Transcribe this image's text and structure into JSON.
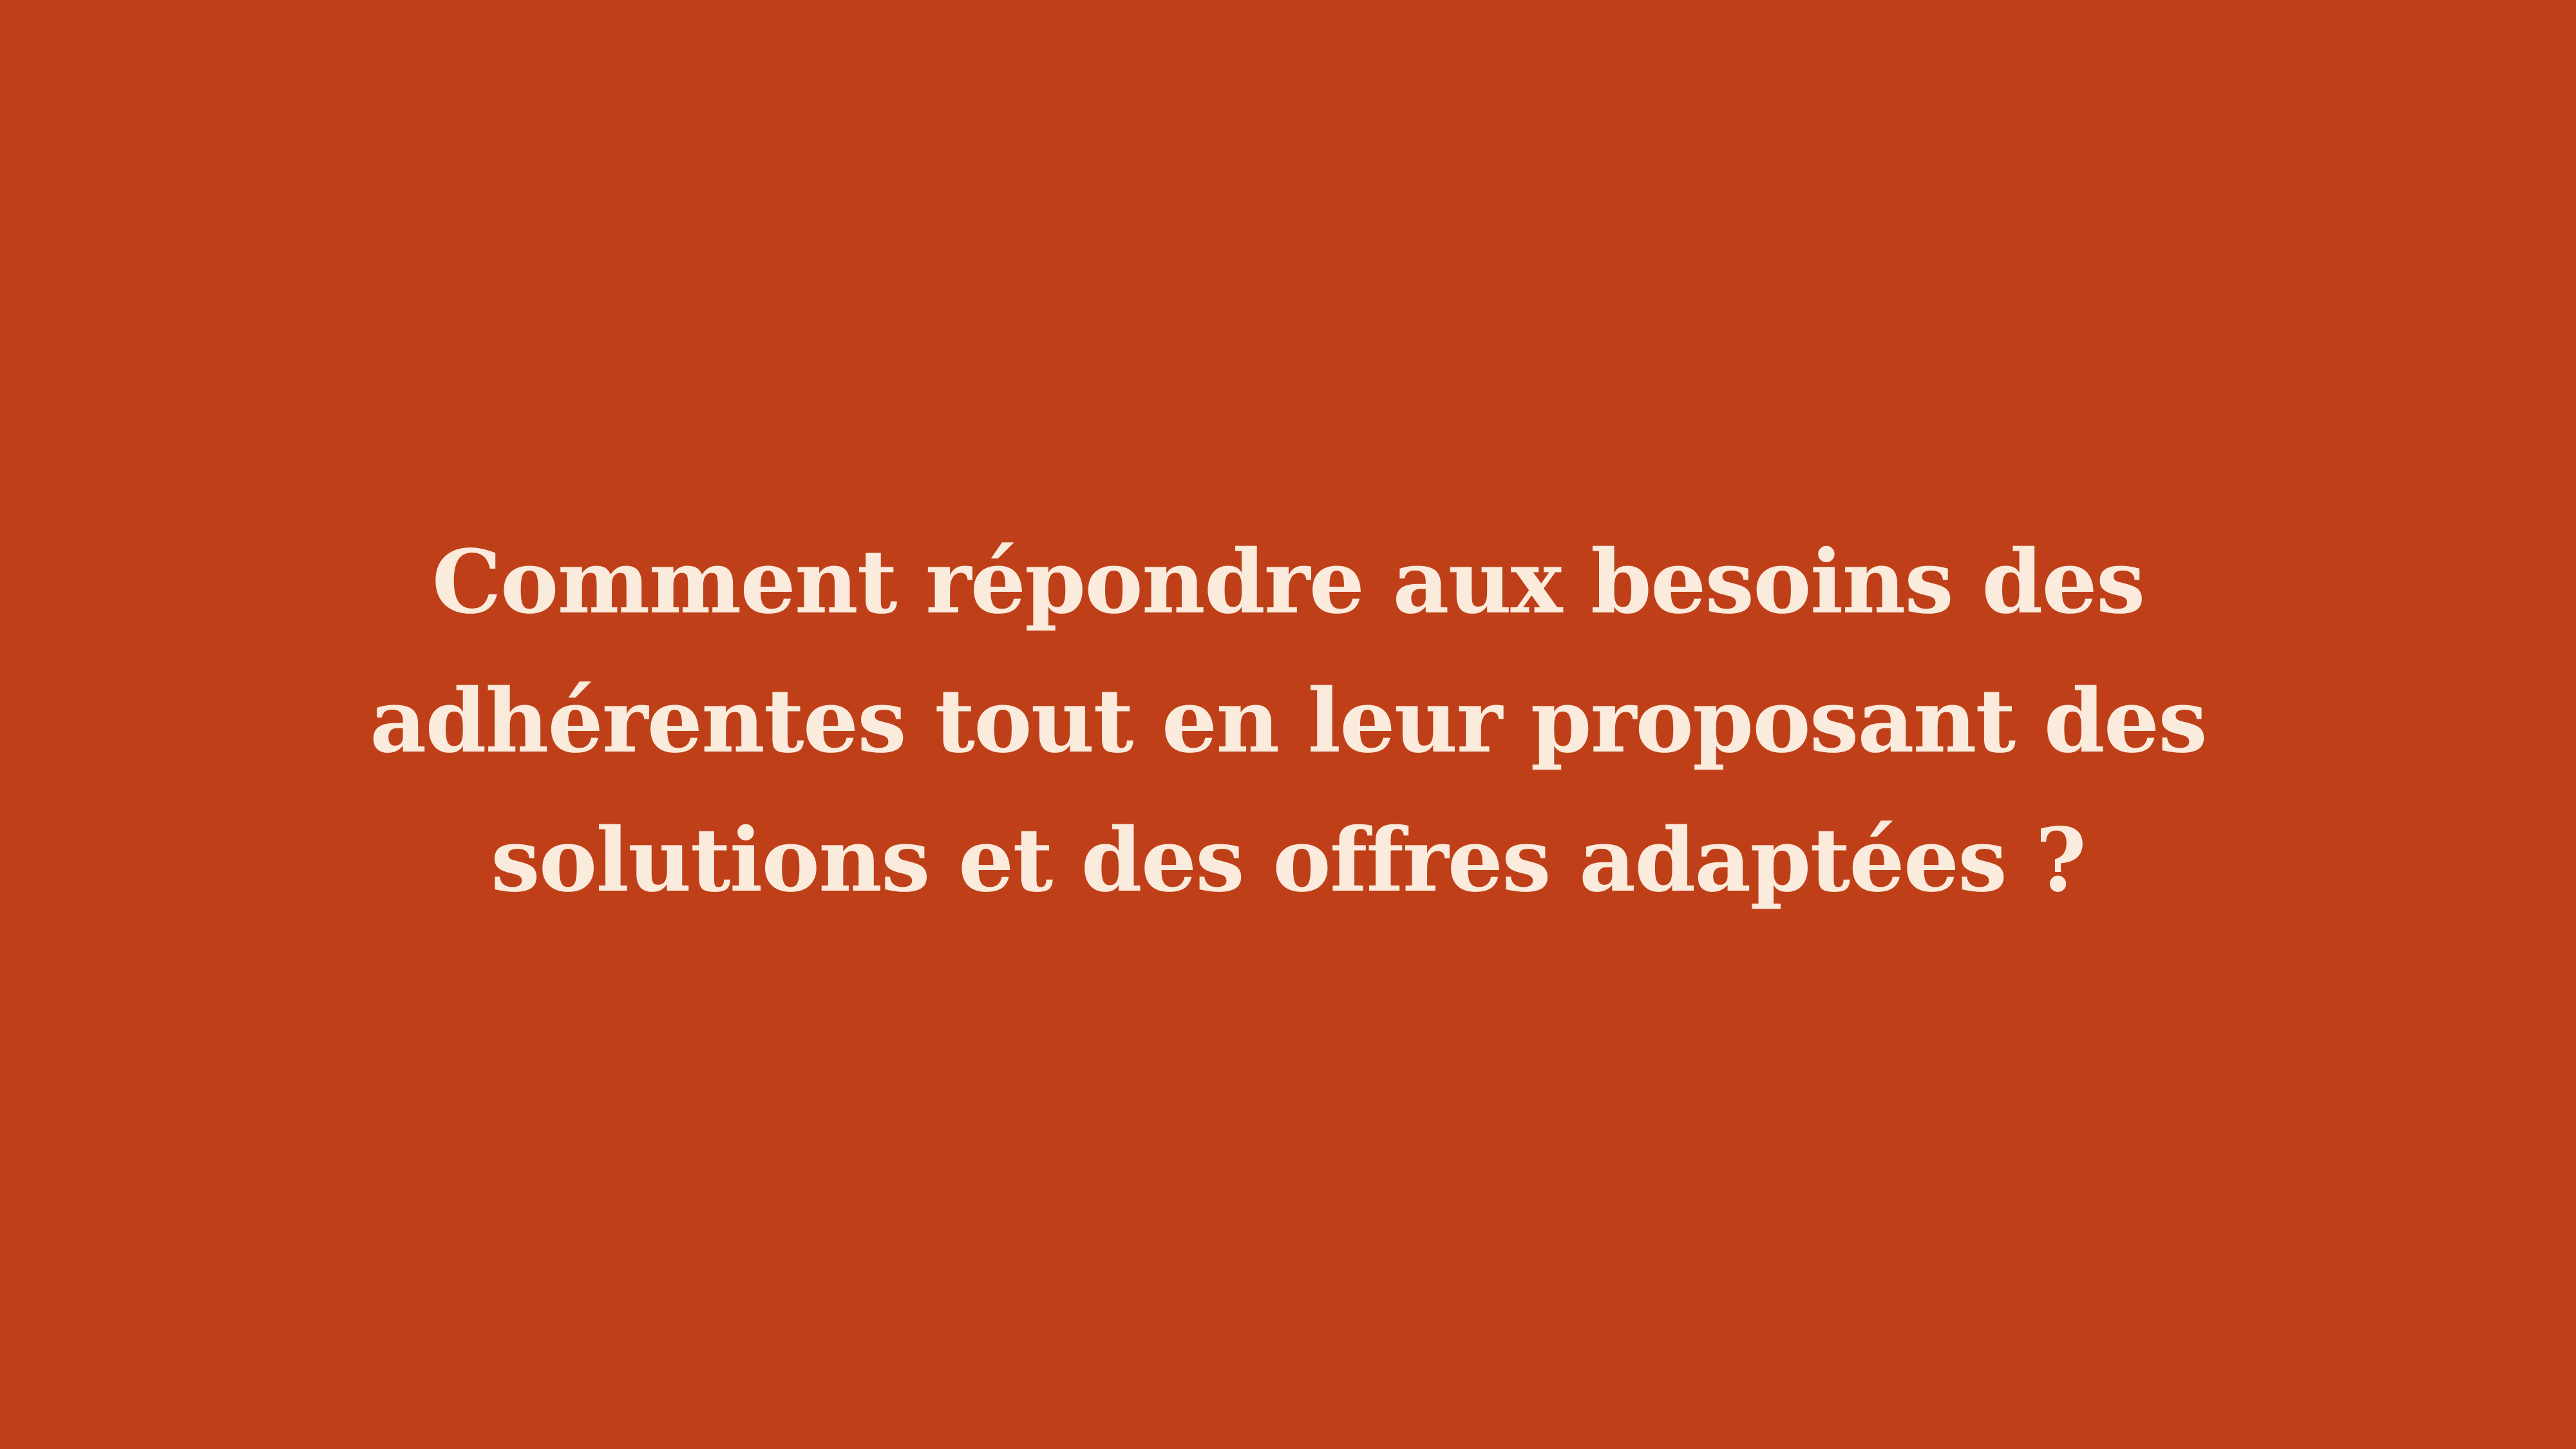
{
  "colors": {
    "background": "#BF4018",
    "text": "#FAEBDD"
  },
  "slide": {
    "question_lines": [
      "Comment répondre aux besoins des",
      "adhérentes tout en leur proposant des",
      "solutions et des offres adaptées ?"
    ]
  }
}
